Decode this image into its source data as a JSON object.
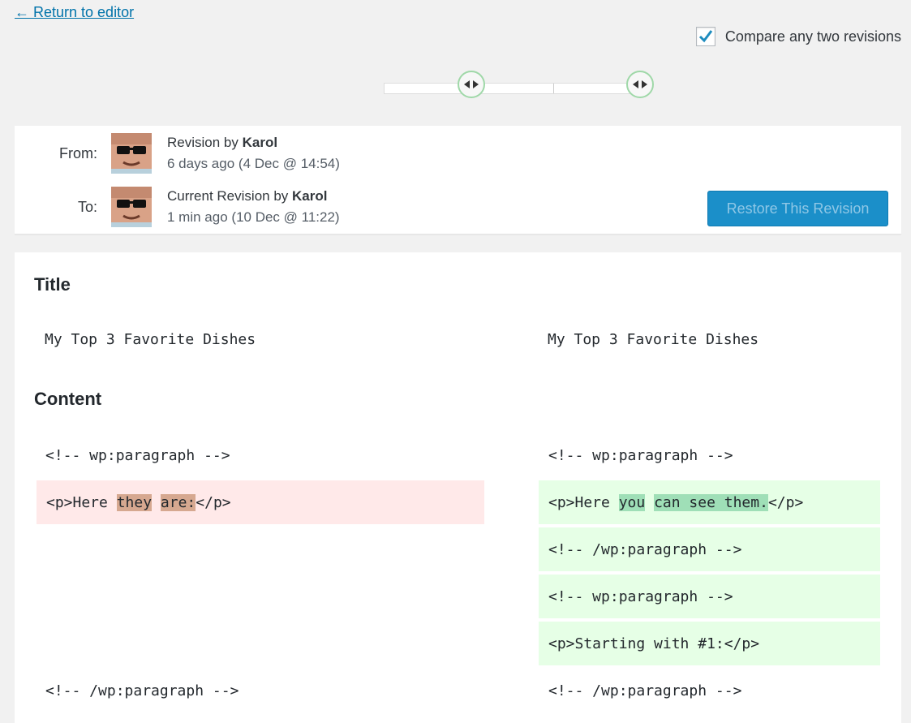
{
  "nav": {
    "return_label": "← Return to editor"
  },
  "compare": {
    "label": "Compare any two revisions",
    "checked": true
  },
  "revisions": {
    "from": {
      "label": "From:",
      "byline_prefix": "Revision by ",
      "author": "Karol",
      "time_ago": "6 days ago",
      "date": "(4 Dec @ 14:54)"
    },
    "to": {
      "label": "To:",
      "byline_prefix": "Current Revision by ",
      "author": "Karol",
      "time_ago": "1 min ago",
      "date": "(10 Dec @ 11:22)"
    },
    "restore_button": "Restore This Revision"
  },
  "diff": {
    "title_heading": "Title",
    "title_left": "My Top 3 Favorite Dishes",
    "title_right": "My Top 3 Favorite Dishes",
    "content_heading": "Content",
    "row1_left": "<!-- wp:paragraph -->",
    "row1_right": "<!-- wp:paragraph -->",
    "row2_left": {
      "pre": "<p>Here ",
      "w1": "they",
      "sp": " ",
      "w2": "are:",
      "post": "</p>"
    },
    "row2_right": {
      "pre": "<p>Here ",
      "w1": "you",
      "sp": " ",
      "w2": "can see them.",
      "post": "</p>"
    },
    "row3_right": "<!-- /wp:paragraph -->",
    "row4_right": "<!-- wp:paragraph -->",
    "row5_right": "<p>Starting with #1:</p>",
    "row6_left": "<!-- /wp:paragraph -->",
    "row6_right": "<!-- /wp:paragraph -->"
  },
  "colors": {
    "link": "#0073aa",
    "deleted_bg": "#ffe9e9",
    "deleted_highlight": "#d6a890",
    "added_bg": "#e6ffe6",
    "added_highlight": "#9fdfb7",
    "primary_button": "#1b8fc9"
  }
}
